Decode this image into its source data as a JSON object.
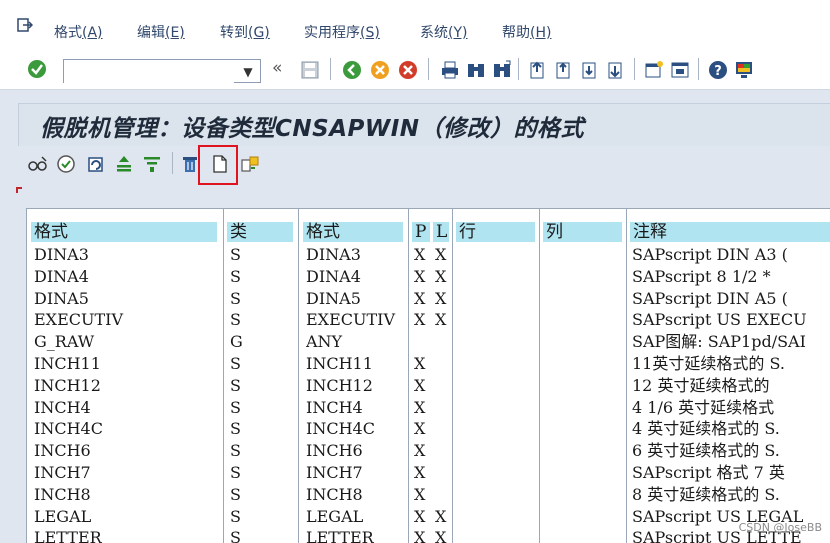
{
  "menu": [
    {
      "label": "格式",
      "accel": "(A)",
      "key": "A"
    },
    {
      "label": "编辑",
      "accel": "(E)",
      "key": "E"
    },
    {
      "label": "转到",
      "accel": "(G)",
      "key": "G"
    },
    {
      "label": "实用程序",
      "accel": "(S)",
      "key": "S"
    },
    {
      "label": "系统",
      "accel": "(Y)",
      "key": "Y"
    },
    {
      "label": "帮助",
      "accel": "(H)",
      "key": "H"
    }
  ],
  "command_field": {
    "value": "",
    "placeholder": ""
  },
  "title": "假脱机管理：设备类型CNSAPWIN（修改）的格式",
  "columns": {
    "format": "格式",
    "type": "类",
    "format2": "格式",
    "p": "P",
    "l": "L",
    "row": "行",
    "col": "列",
    "comment": "注释"
  },
  "rows": [
    {
      "format": "DINA3",
      "type": "S",
      "format2": "DINA3",
      "p": "X",
      "l": "X",
      "comment": "SAPscript DIN A3 ("
    },
    {
      "format": "DINA4",
      "type": "S",
      "format2": "DINA4",
      "p": "X",
      "l": "X",
      "comment": "SAPscript 8 1/2 *"
    },
    {
      "format": "DINA5",
      "type": "S",
      "format2": "DINA5",
      "p": "X",
      "l": "X",
      "comment": "SAPscript DIN A5 ("
    },
    {
      "format": "EXECUTIV",
      "type": "S",
      "format2": "EXECUTIV",
      "p": "X",
      "l": "X",
      "comment": "SAPscript US EXECU"
    },
    {
      "format": "G_RAW",
      "type": "G",
      "format2": "ANY",
      "p": "",
      "l": "",
      "comment": "SAP图解: SAP1pd/SAI"
    },
    {
      "format": "INCH11",
      "type": "S",
      "format2": "INCH11",
      "p": "X",
      "l": "",
      "comment": "11英寸延续格式的 S."
    },
    {
      "format": "INCH12",
      "type": "S",
      "format2": "INCH12",
      "p": "X",
      "l": "",
      "comment": "12 英寸延续格式的 "
    },
    {
      "format": "INCH4",
      "type": "S",
      "format2": "INCH4",
      "p": "X",
      "l": "",
      "comment": "4 1/6 英寸延续格式"
    },
    {
      "format": "INCH4C",
      "type": "S",
      "format2": "INCH4C",
      "p": "X",
      "l": "",
      "comment": "4 英寸延续格式的 S."
    },
    {
      "format": "INCH6",
      "type": "S",
      "format2": "INCH6",
      "p": "X",
      "l": "",
      "comment": "6 英寸延续格式的 S."
    },
    {
      "format": "INCH7",
      "type": "S",
      "format2": "INCH7",
      "p": "X",
      "l": "",
      "comment": "SAPscript 格式 7 英"
    },
    {
      "format": "INCH8",
      "type": "S",
      "format2": "INCH8",
      "p": "X",
      "l": "",
      "comment": "8 英寸延续格式的 S."
    },
    {
      "format": "LEGAL",
      "type": "S",
      "format2": "LEGAL",
      "p": "X",
      "l": "X",
      "comment": "SAPscript US LEGAL"
    },
    {
      "format": "LETTER",
      "type": "S",
      "format2": "LETTER",
      "p": "X",
      "l": "X",
      "comment": "SAPscript US LETTE"
    }
  ],
  "watermark": "CSDN @JoseBB",
  "colors": {
    "header_bg": "#b0e4f0",
    "highlight": "#e0141e",
    "background": "#dfe6ef"
  }
}
